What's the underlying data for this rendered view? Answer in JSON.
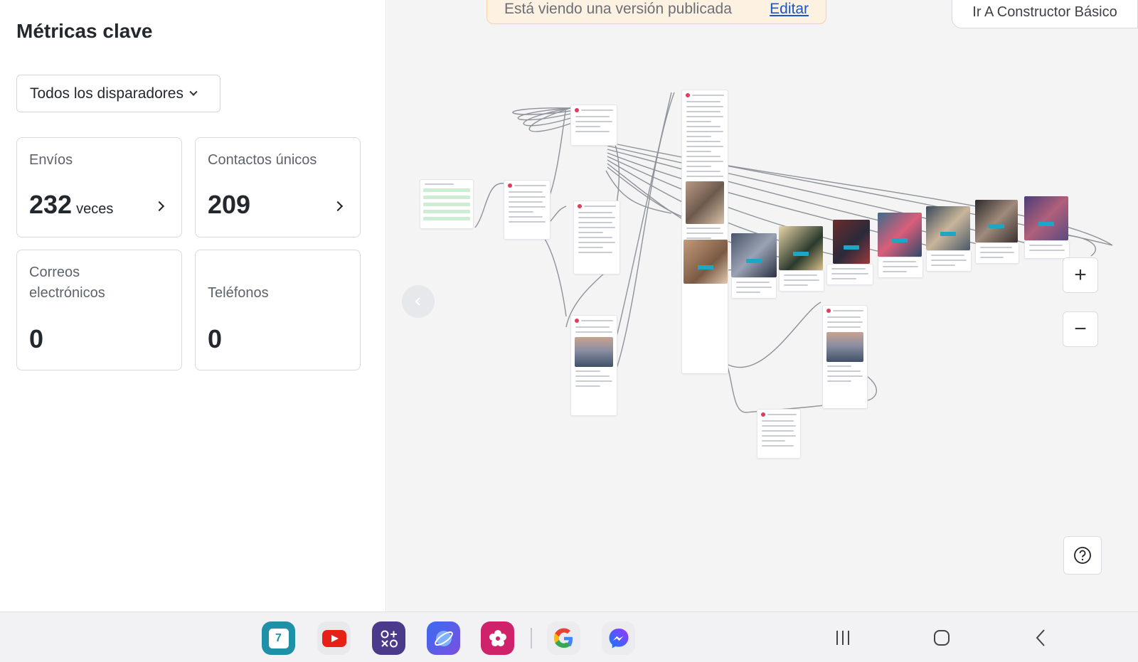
{
  "panel": {
    "title": "Métricas clave",
    "trigger_select": "Todos los disparadores",
    "metrics": {
      "envios": {
        "label": "Envíos",
        "value": "232",
        "unit": "veces"
      },
      "contactos": {
        "label": "Contactos únicos",
        "value": "209"
      },
      "correos": {
        "label": "Correos electrónicos",
        "value": "0"
      },
      "telefonos": {
        "label": "Teléfonos",
        "value": "0"
      }
    }
  },
  "canvas": {
    "banner_text": "Está viendo una versión publicada",
    "banner_edit": "Editar",
    "builder_button": "Ir A Constructor Básico",
    "zoom_in": "+",
    "zoom_out": "−"
  },
  "dock": {
    "apps": [
      "calendar-icon",
      "youtube-icon",
      "apps-icon",
      "browser-icon",
      "gallery-icon",
      "google-icon",
      "messenger-icon"
    ],
    "calendar_day": "7"
  },
  "colors": {
    "accent_link": "#1a56c7",
    "banner_bg": "#fdf1e2",
    "node_green": "#cdeed2",
    "node_badge": "#1ca8c4"
  }
}
